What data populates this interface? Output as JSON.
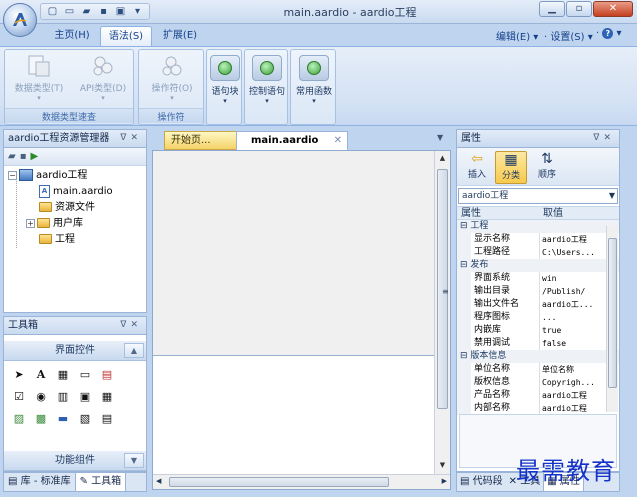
{
  "window": {
    "title": "main.aardio - aardio工程",
    "controls": [
      "minimize",
      "restore",
      "close"
    ]
  },
  "quick_access": [
    "new-icon",
    "window-icon",
    "open-icon",
    "save-icon",
    "save-all-icon",
    "customize-icon"
  ],
  "ribbon": {
    "tabs": [
      {
        "label": "主页(H)",
        "active": false
      },
      {
        "label": "语法(S)",
        "active": true
      },
      {
        "label": "扩展(E)",
        "active": false
      }
    ],
    "right_menu": {
      "edit": "编辑(E)",
      "settings": "设置(S)"
    },
    "groups": [
      {
        "label": "数据类型速查",
        "buttons": [
          {
            "label": "数据类型(T)",
            "enabled": false
          },
          {
            "label": "API类型(D)",
            "enabled": false
          }
        ]
      },
      {
        "label": "操作符",
        "buttons": [
          {
            "label": "操作符(O)",
            "enabled": false
          }
        ]
      },
      {
        "label": "",
        "buttons": [
          {
            "label": "语句块",
            "enabled": true
          }
        ]
      },
      {
        "label": "",
        "buttons": [
          {
            "label": "控制语句",
            "enabled": true
          }
        ]
      },
      {
        "label": "",
        "buttons": [
          {
            "label": "常用函数",
            "enabled": true
          }
        ]
      }
    ]
  },
  "project_panel": {
    "title": "aardio工程资源管理器",
    "tree": [
      {
        "label": "aardio工程",
        "type": "project",
        "expander": "⊟"
      },
      {
        "label": "main.aardio",
        "type": "file"
      },
      {
        "label": "资源文件",
        "type": "folder"
      },
      {
        "label": "用户库",
        "type": "folder",
        "expander": "⊞"
      },
      {
        "label": "工程",
        "type": "folder"
      }
    ]
  },
  "toolbox_panel": {
    "title": "工具箱",
    "section_top": "界面控件",
    "section_bottom": "功能组件",
    "tools": [
      "▲",
      "A",
      "▦",
      "▭",
      "▤",
      "☑",
      "◉",
      "▥",
      "▣",
      "▦",
      "▨",
      "▩",
      "▬",
      "▧",
      "▤"
    ]
  },
  "left_tabs": [
    "库 - 标准库",
    "工具箱"
  ],
  "documents": {
    "tabs": [
      {
        "label": "开始页..."
      },
      {
        "label": "main.aardio",
        "active": true
      }
    ]
  },
  "properties_panel": {
    "title": "属性",
    "toolbar": [
      {
        "label": "插入",
        "icon": "arrow-left-icon"
      },
      {
        "label": "分类",
        "icon": "category-icon",
        "active": true
      },
      {
        "label": "顺序",
        "icon": "sort-az-icon"
      }
    ],
    "object": "aardio工程",
    "columns": [
      "属性",
      "取值"
    ],
    "rows": [
      {
        "type": "category",
        "label": "工程"
      },
      {
        "key": "显示名称",
        "value": "aardio工程"
      },
      {
        "key": "工程路径",
        "value": "C:\\Users..."
      },
      {
        "type": "category",
        "label": "发布"
      },
      {
        "key": "界面系统",
        "value": "win"
      },
      {
        "key": "输出目录",
        "value": "/Publish/"
      },
      {
        "key": "输出文件名",
        "value": "aardio工..."
      },
      {
        "key": "程序图标",
        "value": "..."
      },
      {
        "key": "内嵌库",
        "value": "true"
      },
      {
        "key": "禁用调试",
        "value": "false"
      },
      {
        "type": "category",
        "label": "版本信息"
      },
      {
        "key": "单位名称",
        "value": "单位名称"
      },
      {
        "key": "版权信息",
        "value": "Copyrigh..."
      },
      {
        "key": "产品名称",
        "value": "aardio工程"
      },
      {
        "key": "内部名称",
        "value": "aardio工程"
      }
    ]
  },
  "right_tabs": [
    "代码段",
    "工具",
    "属性"
  ],
  "watermark": "最需教育"
}
